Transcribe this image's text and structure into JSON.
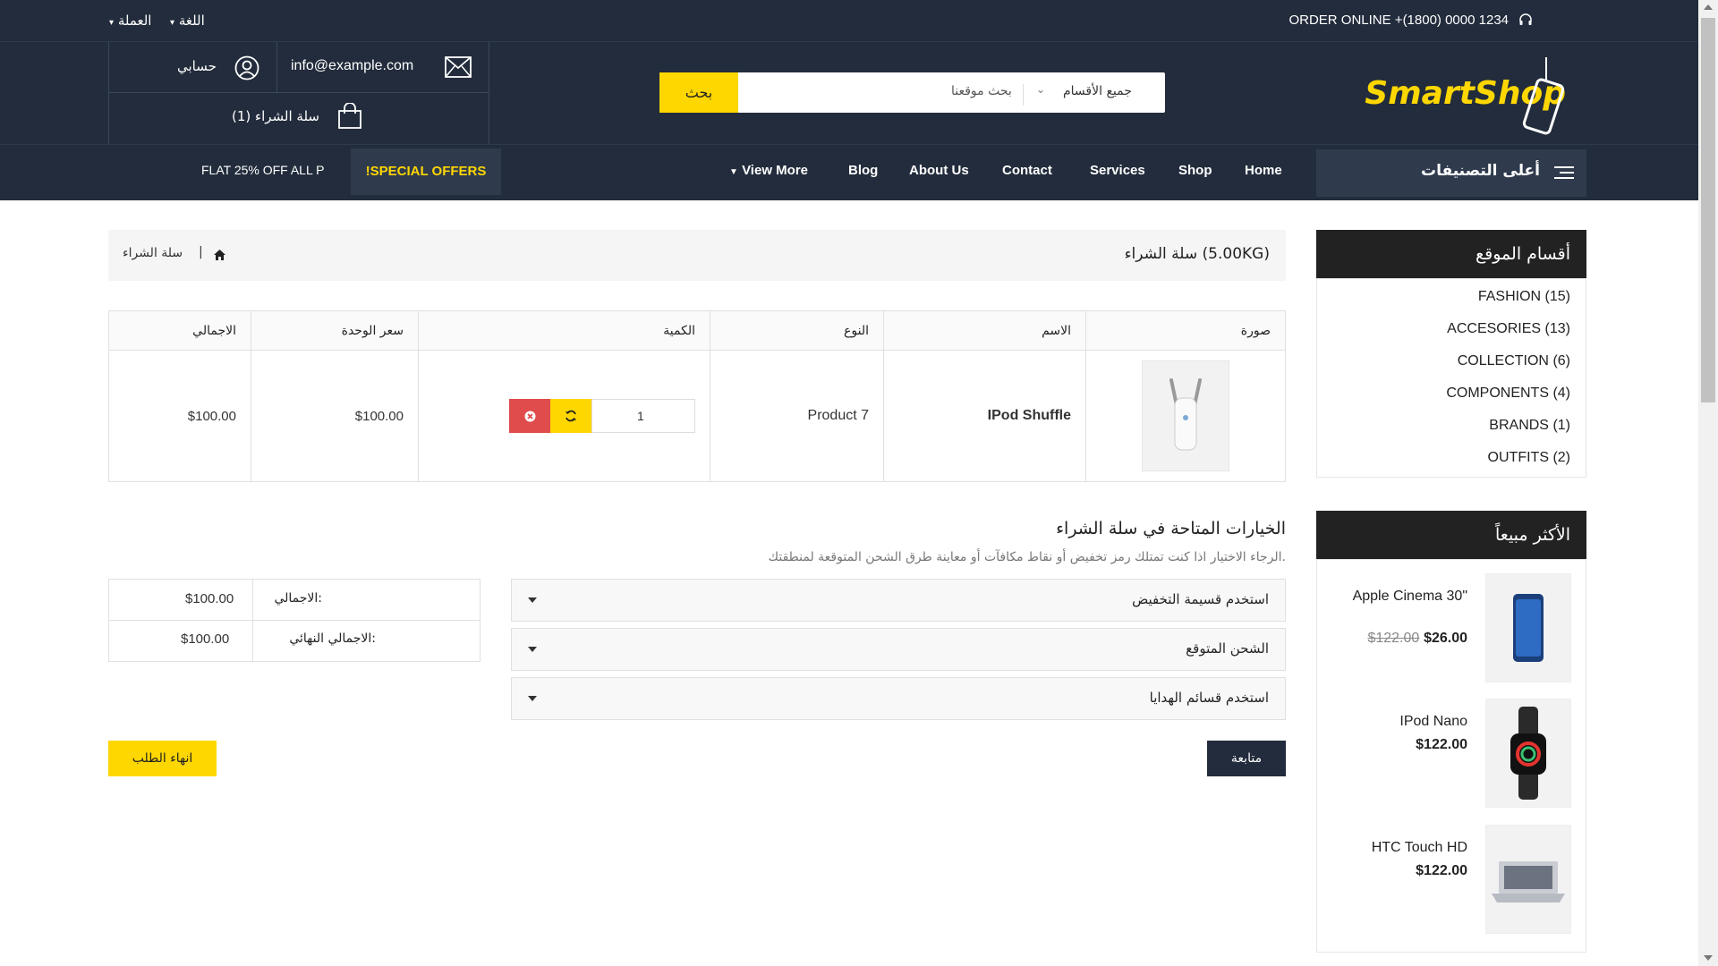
{
  "topbar": {
    "phone": "ORDER ONLINE +(1800) 0000 1234",
    "language": "اللغة",
    "currency": "العملة"
  },
  "header": {
    "logo": "SmartShop",
    "search_placeholder": "بحث موقعنا",
    "search_category": "جميع الأقسام",
    "search_button": "بحث",
    "email": "info@example.com",
    "account": "حسابي",
    "cart": "سلة الشراء (1)"
  },
  "nav": {
    "categories_button": "أعلى التصنيفات",
    "links": [
      "Home",
      "Shop",
      "Services",
      "Contact",
      "About Us",
      "Blog",
      "View More"
    ],
    "special_offers": "!SPECIAL OFFERS",
    "marquee": "FLAT 25% OFF ALL P"
  },
  "sidebar": {
    "categories_title": "أقسام الموقع",
    "categories": [
      {
        "name": "FASHION",
        "count": "(15)"
      },
      {
        "name": "ACCESORIES",
        "count": "(13)"
      },
      {
        "name": "COLLECTION",
        "count": "(6)"
      },
      {
        "name": "COMPONENTS",
        "count": "(4)"
      },
      {
        "name": "BRANDS",
        "count": "(1)"
      },
      {
        "name": "OUTFITS",
        "count": "(2)"
      }
    ],
    "bestseller_title": "الأكثر مبيعاً",
    "bestsellers": [
      {
        "name": "Apple Cinema 30\"",
        "price": "$26.00",
        "old_price": "$122.00"
      },
      {
        "name": "IPod Nano",
        "price": "$122.00",
        "old_price": ""
      },
      {
        "name": "HTC Touch HD",
        "price": "$122.00",
        "old_price": ""
      }
    ]
  },
  "breadcrumb": {
    "title": "سلة الشراء  (5.00KG)",
    "current": "سلة الشراء",
    "separator": "|"
  },
  "cart_table": {
    "headers": {
      "image": "صورة",
      "name": "الاسم",
      "model": "النوع",
      "quantity": "الكمية",
      "unit_price": "سعر الوحدة",
      "total": "الاجمالي"
    },
    "rows": [
      {
        "name": "IPod Shuffle",
        "model": "Product 7",
        "quantity": "1",
        "unit_price": "$100.00",
        "total": "$100.00"
      }
    ]
  },
  "options": {
    "title": "الخيارات المتاحة في سلة الشراء",
    "subtitle": "الرجاء الاختيار اذا كنت تمتلك رمز تخفيض أو نقاط مكافآت أو معاينة طرق الشحن المتوقعة لمنطقتك.",
    "accordions": [
      "استخدم قسيمة التخفيض",
      "الشحن المتوقع",
      "استخدم قسائم الهدايا"
    ]
  },
  "totals": {
    "subtotal_label": "الاجمالي:",
    "subtotal_value": "$100.00",
    "total_label": "الاجمالي النهائي:",
    "total_value": "$100.00"
  },
  "buttons": {
    "continue": "متابعة",
    "checkout": "انهاء الطلب"
  },
  "colors": {
    "dark": "#222c3c",
    "accent": "#fed701",
    "danger": "#e04b4b"
  }
}
